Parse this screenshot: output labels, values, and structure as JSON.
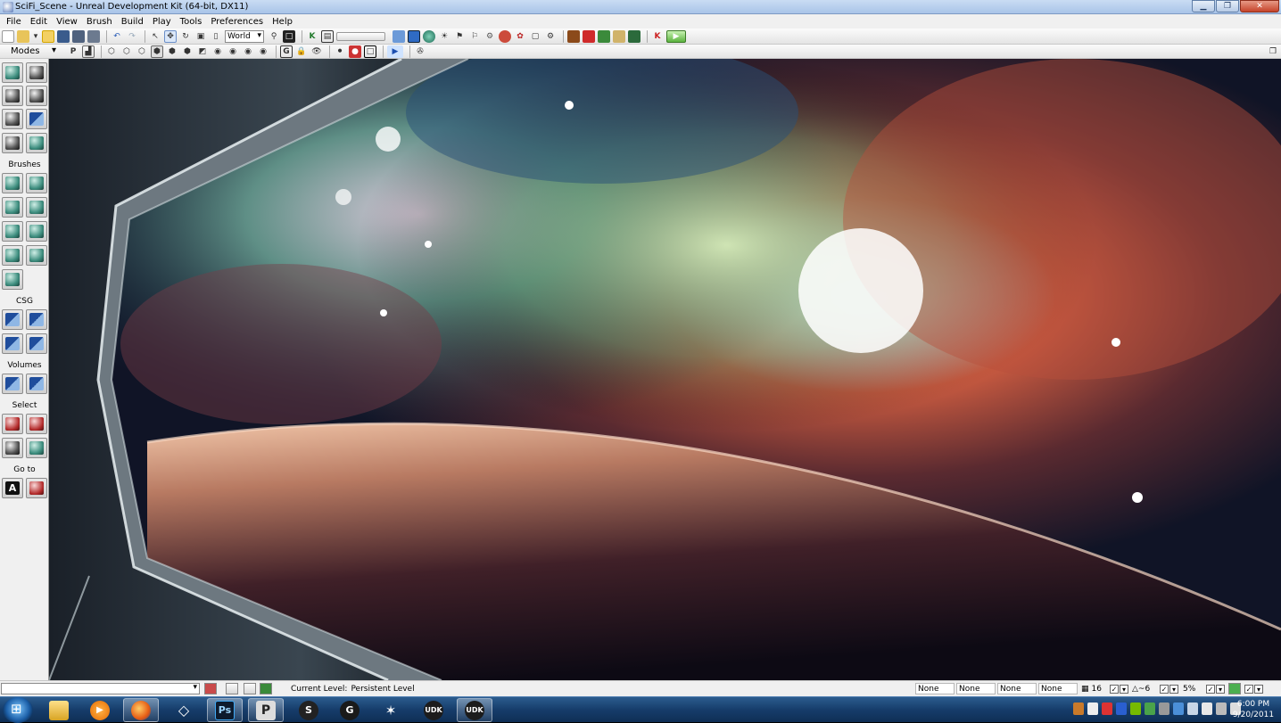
{
  "window": {
    "title": "SciFi_Scene - Unreal Development Kit (64-bit, DX11)"
  },
  "menu": [
    "File",
    "Edit",
    "View",
    "Brush",
    "Build",
    "Play",
    "Tools",
    "Preferences",
    "Help"
  ],
  "toolbar": {
    "coordinate_system": "World"
  },
  "toolbar2": {
    "modes_label": "Modes"
  },
  "modes_panel": {
    "sections": {
      "brushes": "Brushes",
      "csg": "CSG",
      "volumes": "Volumes",
      "select": "Select",
      "goto": "Go to"
    }
  },
  "statusbar": {
    "current_level_label": "Current Level:",
    "current_level_value": "Persistent Level",
    "fields": [
      "None",
      "None",
      "None",
      "None"
    ],
    "grid_size": "16",
    "rotation_snap": "~6",
    "scale_snap": "5%"
  },
  "taskbar": {
    "apps": [
      "start-orb-icon",
      "windows-explorer-icon",
      "media-player-icon",
      "firefox-icon",
      "unity-icon",
      "photoshop-icon",
      "perforce-icon",
      "app-s-icon",
      "app-g-icon",
      "zbrush-icon",
      "udk-icon",
      "udk-icon"
    ],
    "ps_label": "Ps",
    "p_label": "P",
    "udk_label": "UDK",
    "clock_time": "6:00 PM",
    "clock_date": "9/20/2011"
  },
  "colors": {
    "udk_red": "#8f1010",
    "nebula_red": "#b83a2c",
    "nebula_teal": "#3c8f7c",
    "planet": "#c98a6a"
  }
}
